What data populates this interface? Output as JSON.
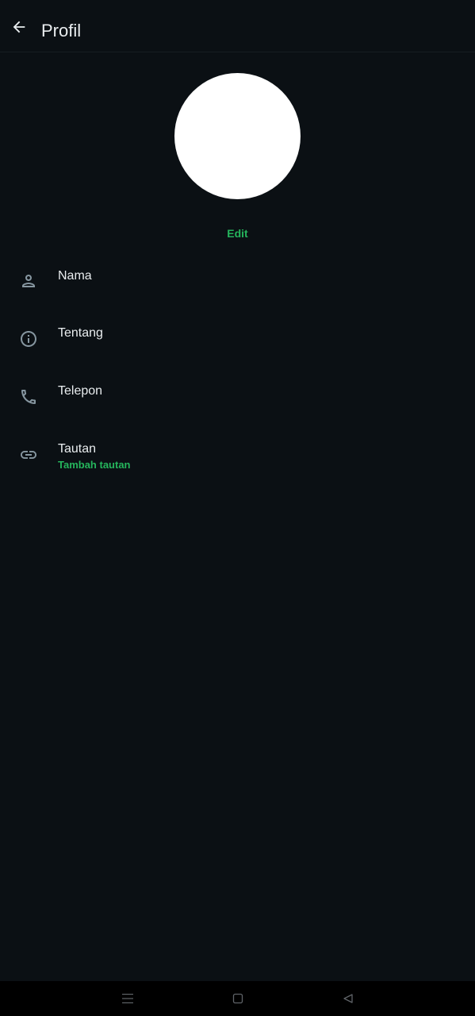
{
  "header": {
    "title": "Profil",
    "back_icon": "arrow-left-icon"
  },
  "avatar": {
    "color": "#ffffff"
  },
  "edit_label": "Edit",
  "accent_color": "#25b55c",
  "rows": [
    {
      "icon": "person-icon",
      "label": "Nama"
    },
    {
      "icon": "info-icon",
      "label": "Tentang"
    },
    {
      "icon": "phone-icon",
      "label": "Telepon"
    },
    {
      "icon": "link-icon",
      "label": "Tautan",
      "sub": "Tambah tautan"
    }
  ],
  "navigation": {
    "items": [
      "menu-icon",
      "home-square-icon",
      "back-triangle-icon"
    ]
  }
}
